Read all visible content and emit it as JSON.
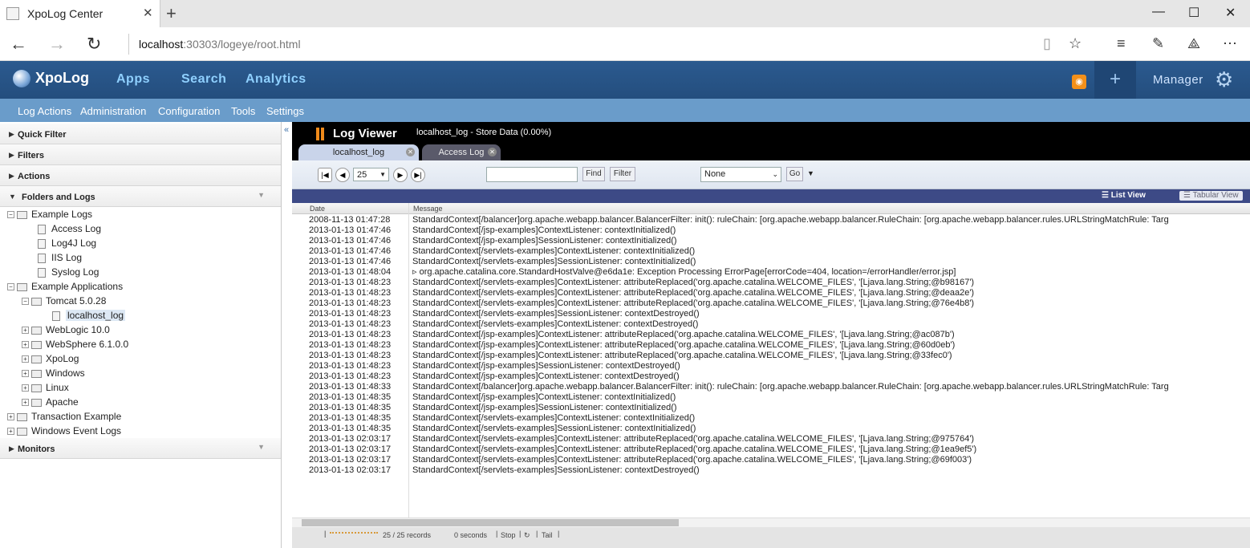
{
  "browser": {
    "tab_title": "XpoLog Center",
    "url_host": "localhost",
    "url_rest": ":30303/logeye/root.html"
  },
  "app": {
    "logo": "XpoLog",
    "nav": [
      "Apps",
      "Search",
      "Analytics"
    ],
    "manager_label": "Manager",
    "subnav": [
      "Log Actions",
      "Administration",
      "Configuration",
      "Tools",
      "Settings"
    ]
  },
  "left_panel": {
    "sections": [
      "Quick Filter",
      "Filters",
      "Actions",
      "Folders and Logs",
      "Monitors"
    ],
    "tree": [
      {
        "label": "Example Logs",
        "type": "folder",
        "expander": "-"
      },
      {
        "label": "Access Log",
        "type": "file"
      },
      {
        "label": "Log4J Log",
        "type": "file"
      },
      {
        "label": "IIS Log",
        "type": "file"
      },
      {
        "label": "Syslog Log",
        "type": "file"
      },
      {
        "label": "Example Applications",
        "type": "folder",
        "expander": "-"
      },
      {
        "label": "Tomcat 5.0.28",
        "type": "folder",
        "expander": "-"
      },
      {
        "label": "localhost_log",
        "type": "file",
        "selected": true
      },
      {
        "label": "WebLogic 10.0",
        "type": "folder",
        "expander": "+"
      },
      {
        "label": "WebSphere 6.1.0.0",
        "type": "folder",
        "expander": "+"
      },
      {
        "label": "XpoLog",
        "type": "folder",
        "expander": "+"
      },
      {
        "label": "Windows",
        "type": "folder",
        "expander": "+"
      },
      {
        "label": "Linux",
        "type": "folder",
        "expander": "+"
      },
      {
        "label": "Apache",
        "type": "folder",
        "expander": "+"
      },
      {
        "label": "Transaction Example",
        "type": "folder",
        "expander": "+"
      },
      {
        "label": "Windows Event Logs",
        "type": "folder",
        "expander": "+"
      }
    ]
  },
  "viewer": {
    "title": "Log Viewer",
    "subtitle": "localhost_log  - Store Data (0.00%)",
    "tabs": [
      "localhost_log",
      "Access Log"
    ],
    "page_size": "25",
    "find_label": "Find",
    "filter_label": "Filter",
    "select_value": "None",
    "go_label": "Go",
    "list_view": "List View",
    "tabular_view": "Tabular View",
    "columns": [
      "Date",
      "Message"
    ],
    "rows": [
      {
        "date": "2008-11-13 01:47:28",
        "msg": "StandardContext[/balancer]org.apache.webapp.balancer.BalancerFilter: init(): ruleChain: [org.apache.webapp.balancer.RuleChain: [org.apache.webapp.balancer.rules.URLStringMatchRule: Targ"
      },
      {
        "date": "2013-01-13 01:47:46",
        "msg": "StandardContext[/jsp-examples]ContextListener: contextInitialized()"
      },
      {
        "date": "2013-01-13 01:47:46",
        "msg": "StandardContext[/jsp-examples]SessionListener: contextInitialized()"
      },
      {
        "date": "2013-01-13 01:47:46",
        "msg": "StandardContext[/servlets-examples]ContextListener: contextInitialized()"
      },
      {
        "date": "2013-01-13 01:47:46",
        "msg": "StandardContext[/servlets-examples]SessionListener: contextInitialized()"
      },
      {
        "date": "2013-01-13 01:48:04",
        "msg": "▹ org.apache.catalina.core.StandardHostValve@e6da1e: Exception Processing ErrorPage[errorCode=404, location=/errorHandler/error.jsp]"
      },
      {
        "date": "2013-01-13 01:48:23",
        "msg": "StandardContext[/servlets-examples]ContextListener: attributeReplaced('org.apache.catalina.WELCOME_FILES', '[Ljava.lang.String;@b98167')"
      },
      {
        "date": "2013-01-13 01:48:23",
        "msg": "StandardContext[/servlets-examples]ContextListener: attributeReplaced('org.apache.catalina.WELCOME_FILES', '[Ljava.lang.String;@deaa2e')"
      },
      {
        "date": "2013-01-13 01:48:23",
        "msg": "StandardContext[/servlets-examples]ContextListener: attributeReplaced('org.apache.catalina.WELCOME_FILES', '[Ljava.lang.String;@76e4b8')"
      },
      {
        "date": "2013-01-13 01:48:23",
        "msg": "StandardContext[/servlets-examples]SessionListener: contextDestroyed()"
      },
      {
        "date": "2013-01-13 01:48:23",
        "msg": "StandardContext[/servlets-examples]ContextListener: contextDestroyed()"
      },
      {
        "date": "2013-01-13 01:48:23",
        "msg": "StandardContext[/jsp-examples]ContextListener: attributeReplaced('org.apache.catalina.WELCOME_FILES', '[Ljava.lang.String;@ac087b')"
      },
      {
        "date": "2013-01-13 01:48:23",
        "msg": "StandardContext[/jsp-examples]ContextListener: attributeReplaced('org.apache.catalina.WELCOME_FILES', '[Ljava.lang.String;@60d0eb')"
      },
      {
        "date": "2013-01-13 01:48:23",
        "msg": "StandardContext[/jsp-examples]ContextListener: attributeReplaced('org.apache.catalina.WELCOME_FILES', '[Ljava.lang.String;@33fec0')"
      },
      {
        "date": "2013-01-13 01:48:23",
        "msg": "StandardContext[/jsp-examples]SessionListener: contextDestroyed()"
      },
      {
        "date": "2013-01-13 01:48:23",
        "msg": "StandardContext[/jsp-examples]ContextListener: contextDestroyed()"
      },
      {
        "date": "2013-01-13 01:48:33",
        "msg": "StandardContext[/balancer]org.apache.webapp.balancer.BalancerFilter: init(): ruleChain: [org.apache.webapp.balancer.RuleChain: [org.apache.webapp.balancer.rules.URLStringMatchRule: Targ"
      },
      {
        "date": "2013-01-13 01:48:35",
        "msg": "StandardContext[/jsp-examples]ContextListener: contextInitialized()"
      },
      {
        "date": "2013-01-13 01:48:35",
        "msg": "StandardContext[/jsp-examples]SessionListener: contextInitialized()"
      },
      {
        "date": "2013-01-13 01:48:35",
        "msg": "StandardContext[/servlets-examples]ContextListener: contextInitialized()"
      },
      {
        "date": "2013-01-13 01:48:35",
        "msg": "StandardContext[/servlets-examples]SessionListener: contextInitialized()"
      },
      {
        "date": "2013-01-13 02:03:17",
        "msg": "StandardContext[/servlets-examples]ContextListener: attributeReplaced('org.apache.catalina.WELCOME_FILES', '[Ljava.lang.String;@975764')"
      },
      {
        "date": "2013-01-13 02:03:17",
        "msg": "StandardContext[/servlets-examples]ContextListener: attributeReplaced('org.apache.catalina.WELCOME_FILES', '[Ljava.lang.String;@1ea9ef5')"
      },
      {
        "date": "2013-01-13 02:03:17",
        "msg": "StandardContext[/servlets-examples]ContextListener: attributeReplaced('org.apache.catalina.WELCOME_FILES', '[Ljava.lang.String;@69f003')"
      },
      {
        "date": "2013-01-13 02:03:17",
        "msg": "StandardContext[/servlets-examples]SessionListener: contextDestroyed()"
      }
    ],
    "status": {
      "records": "25 / 25 records",
      "time": "0 seconds",
      "stop": "Stop",
      "tail": "Tail"
    }
  },
  "colors": {
    "accent": "#2b5a8f",
    "subnav": "#6a9cca",
    "rss": "#f39019",
    "viewer_bar": "#3d4a86"
  }
}
